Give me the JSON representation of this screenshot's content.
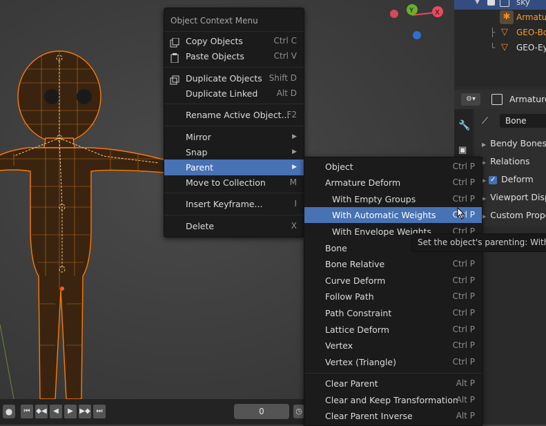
{
  "context_menu": {
    "title": "Object Context Menu",
    "items": [
      {
        "label": "Copy Objects",
        "shortcut": "Ctrl C"
      },
      {
        "label": "Paste Objects",
        "shortcut": "Ctrl V"
      },
      {
        "label": "Duplicate Objects",
        "shortcut": "Shift D"
      },
      {
        "label": "Duplicate Linked",
        "shortcut": "Alt D"
      },
      {
        "label": "Rename Active Object...",
        "shortcut": "F2"
      },
      {
        "label": "Mirror",
        "shortcut": ""
      },
      {
        "label": "Snap",
        "shortcut": ""
      },
      {
        "label": "Parent",
        "shortcut": ""
      },
      {
        "label": "Move to Collection",
        "shortcut": "M"
      },
      {
        "label": "Insert Keyframe...",
        "shortcut": "I"
      },
      {
        "label": "Delete",
        "shortcut": "X"
      }
    ]
  },
  "parent_submenu": {
    "items": [
      {
        "label": "Object",
        "shortcut": "Ctrl P"
      },
      {
        "label": "Armature Deform",
        "shortcut": "Ctrl P"
      },
      {
        "label": "With Empty Groups",
        "shortcut": "Ctrl P"
      },
      {
        "label": "With Automatic Weights",
        "shortcut": "Ctrl P"
      },
      {
        "label": "With Envelope Weights",
        "shortcut": "Ctrl P"
      },
      {
        "label": "Bone",
        "shortcut": ""
      },
      {
        "label": "Bone Relative",
        "shortcut": "Ctrl P"
      },
      {
        "label": "Curve Deform",
        "shortcut": "Ctrl P"
      },
      {
        "label": "Follow Path",
        "shortcut": "Ctrl P"
      },
      {
        "label": "Path Constraint",
        "shortcut": "Ctrl P"
      },
      {
        "label": "Lattice Deform",
        "shortcut": "Ctrl P"
      },
      {
        "label": "Vertex",
        "shortcut": "Ctrl P"
      },
      {
        "label": "Vertex (Triangle)",
        "shortcut": "Ctrl P"
      },
      {
        "label": "Clear Parent",
        "shortcut": "Alt P"
      },
      {
        "label": "Clear and Keep Transformation",
        "shortcut": "Alt P"
      },
      {
        "label": "Clear Parent Inverse",
        "shortcut": "Alt P"
      }
    ]
  },
  "tooltip": {
    "text": "Set the object's parenting:  With"
  },
  "outliner": {
    "rows": [
      {
        "label": "sky",
        "icon": "collection-icon"
      },
      {
        "label": "Armatur",
        "icon": "armature-icon"
      },
      {
        "label": "GEO-Bo",
        "icon": "mesh-icon"
      },
      {
        "label": "GEO-Eye",
        "icon": "mesh-icon"
      }
    ]
  },
  "properties": {
    "header_title": "Armature",
    "bone_name": "Bone",
    "panels": [
      {
        "label": "Bendy Bones"
      },
      {
        "label": "Relations"
      },
      {
        "label": "Deform"
      },
      {
        "label": "Viewport Disp"
      },
      {
        "label": "Custom Prope"
      }
    ]
  },
  "timeline": {
    "current_frame": "0"
  },
  "gizmo": {
    "y_label": "Y",
    "x_label": "X"
  },
  "colors": {
    "accent": "#4772b3",
    "selection_orange": "#ff7a00",
    "menu_bg": "#1b1b1b",
    "gizmo_x": "#e84a5f",
    "gizmo_y": "#6ab02b",
    "gizmo_z": "#2f6fd1"
  }
}
